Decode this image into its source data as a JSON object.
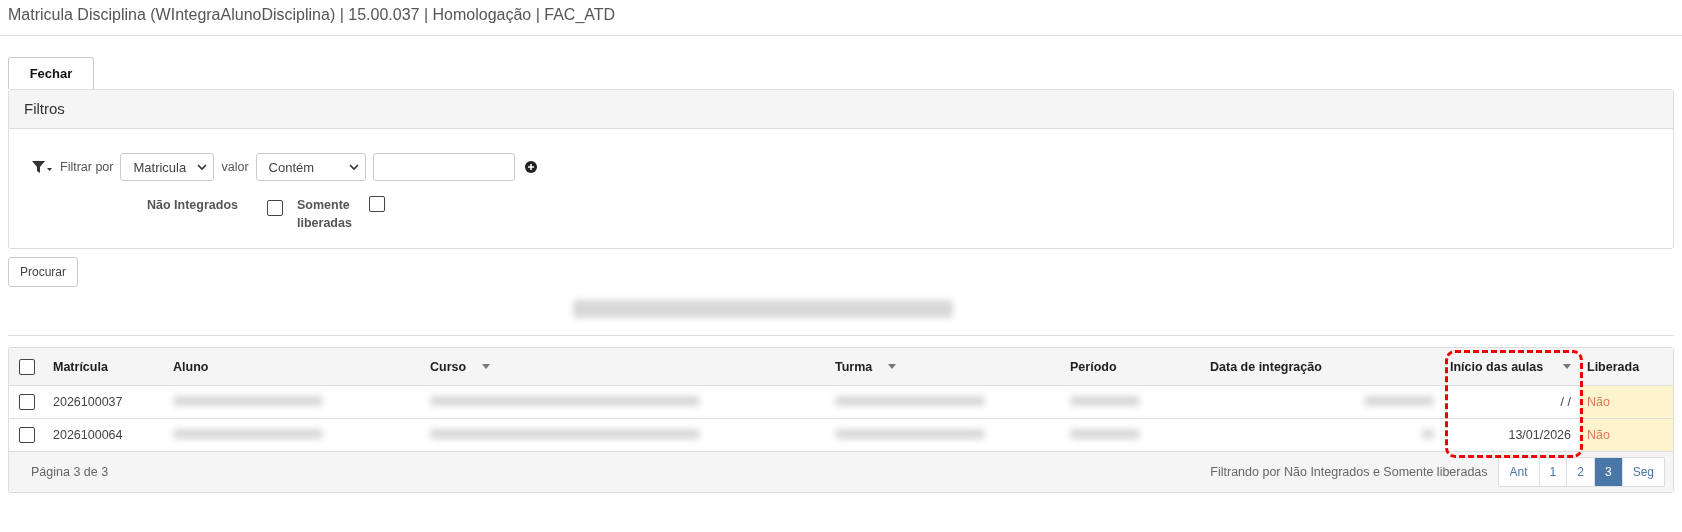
{
  "window": {
    "title": "Matricula Disciplina (WIntegraAlunoDisciplina) | 15.00.037 | Homologação | FAC_ATD"
  },
  "close_button": "Fechar",
  "filters": {
    "title": "Filtros",
    "filter_by_label": "Filtrar por",
    "field_select": "Matricula",
    "value_label": "valor",
    "operator_select": "Contém",
    "checkboxes": [
      {
        "label": "Não Integrados",
        "checked": false
      },
      {
        "label": "Somente liberadas",
        "checked": false
      }
    ]
  },
  "search_button": "Procurar",
  "table": {
    "select_all": {
      "checked": false
    },
    "columns": [
      {
        "label": "Matrícula",
        "sortable": false
      },
      {
        "label": "Aluno",
        "sortable": false
      },
      {
        "label": "Curso",
        "sortable": true
      },
      {
        "label": "Turma",
        "sortable": true
      },
      {
        "label": "Período",
        "sortable": false
      },
      {
        "label": "Data de integração",
        "sortable": false
      },
      {
        "label": "Início das aulas",
        "sortable": true,
        "highlighted": true
      },
      {
        "label": "Liberada",
        "sortable": false
      }
    ],
    "rows": [
      {
        "checked": false,
        "cells": [
          {
            "kind": "text",
            "text": "2026100037"
          },
          {
            "kind": "blurred"
          },
          {
            "kind": "blurred"
          },
          {
            "kind": "blurred"
          },
          {
            "kind": "blurred"
          },
          {
            "kind": "blurred"
          },
          {
            "kind": "text",
            "text": "/ /"
          },
          {
            "kind": "status",
            "text": "Não"
          }
        ]
      },
      {
        "checked": false,
        "cells": [
          {
            "kind": "text",
            "text": "2026100064"
          },
          {
            "kind": "blurred"
          },
          {
            "kind": "blurred"
          },
          {
            "kind": "blurred"
          },
          {
            "kind": "blurred"
          },
          {
            "kind": "blurred"
          },
          {
            "kind": "text",
            "text": "13/01/2026"
          },
          {
            "kind": "status",
            "text": "Não"
          }
        ]
      }
    ],
    "footer": {
      "page_info": "Página 3 de 3",
      "filter_info": "Filtrando por Não Integrados e Somente liberadas",
      "pages": [
        {
          "label": "Ant",
          "selected": false
        },
        {
          "label": "1",
          "selected": false
        },
        {
          "label": "2",
          "selected": false
        },
        {
          "label": "3",
          "selected": true
        },
        {
          "label": "Seg",
          "selected": false
        }
      ]
    }
  }
}
